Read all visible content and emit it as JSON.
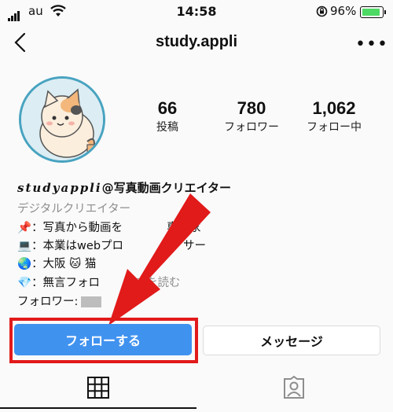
{
  "status": {
    "carrier": "au",
    "time": "14:58",
    "battery": "96%"
  },
  "nav": {
    "username": "study.appli"
  },
  "stats": [
    {
      "value": "66",
      "label": "投稿"
    },
    {
      "value": "780",
      "label": "フォロワー"
    },
    {
      "value": "1,062",
      "label": "フォロー中"
    }
  ],
  "bio": {
    "name_script": "studyappli",
    "name_rest": "@写真動画クリエイター",
    "category": "デジタルクリエイター",
    "lines": [
      {
        "icon": "📌",
        "text": "：写真から動画を",
        "text2": "専門家"
      },
      {
        "icon": "💻",
        "text": "：本業はwebプロ",
        "text2": "サー"
      },
      {
        "icon": "🌏",
        "text": "：大阪 🐱 猫"
      },
      {
        "icon": "💎",
        "text": "：無言フォロ",
        "more": "続きを読む"
      }
    ],
    "followers_label": "フォロワー:"
  },
  "buttons": {
    "follow": "フォローする",
    "message": "メッセージ"
  },
  "colors": {
    "follow_button": "#4092ef",
    "highlight": "#e11a1a",
    "avatar_border": "#48a3c0"
  }
}
